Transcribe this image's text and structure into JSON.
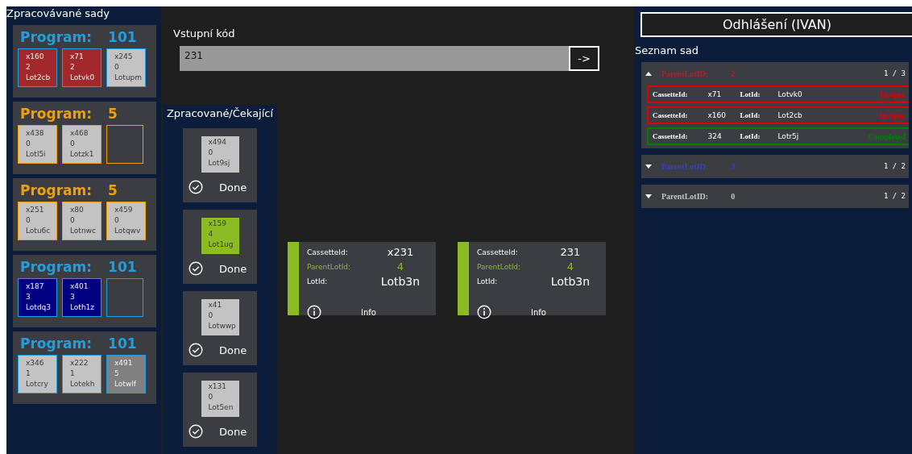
{
  "left_panel": {
    "title": "Zpracovávané sady",
    "programs": [
      {
        "label": "Program:",
        "number": "101",
        "color": "#1ea0e0",
        "tiles": [
          {
            "kind": "lot",
            "color": "#a3282b",
            "cassette": "x160",
            "count": "2",
            "lot": "Lot2cb"
          },
          {
            "kind": "lot",
            "color": "#a3282b",
            "cassette": "x71",
            "count": "2",
            "lot": "Lotvk0"
          },
          {
            "kind": "lot",
            "color": "#c3c3c3",
            "cassette": "x245",
            "count": "0",
            "lot": "Lotupm"
          }
        ]
      },
      {
        "label": "Program:",
        "number": "5",
        "color": "#f0a000",
        "tiles": [
          {
            "kind": "lot",
            "color": "#c3c3c3",
            "cassette": "x438",
            "count": "0",
            "lot": "Lotl5i"
          },
          {
            "kind": "lot",
            "color": "#c3c3c3",
            "cassette": "x468",
            "count": "0",
            "lot": "Lotzk1"
          },
          {
            "kind": "empty"
          }
        ]
      },
      {
        "label": "Program:",
        "number": "5",
        "color": "#f0a000",
        "tiles": [
          {
            "kind": "lot",
            "color": "#c3c3c3",
            "cassette": "x251",
            "count": "0",
            "lot": "Lotu6c"
          },
          {
            "kind": "lot",
            "color": "#c3c3c3",
            "cassette": "x80",
            "count": "0",
            "lot": "Lotnwc"
          },
          {
            "kind": "lot",
            "color": "#c3c3c3",
            "cassette": "x459",
            "count": "0",
            "lot": "Lotqwv"
          }
        ]
      },
      {
        "label": "Program:",
        "number": "101",
        "color": "#1ea0e0",
        "tiles": [
          {
            "kind": "lot",
            "color": "#000080",
            "cassette": "x187",
            "count": "3",
            "lot": "Lotdq3"
          },
          {
            "kind": "lot",
            "color": "#000080",
            "cassette": "x401",
            "count": "3",
            "lot": "Loth1z"
          },
          {
            "kind": "empty"
          }
        ]
      },
      {
        "label": "Program:",
        "number": "101",
        "color": "#1ea0e0",
        "tiles": [
          {
            "kind": "lot",
            "color": "#c3c3c3",
            "cassette": "x346",
            "count": "1",
            "lot": "Lotcry"
          },
          {
            "kind": "lot",
            "color": "#c3c3c3",
            "cassette": "x222",
            "count": "1",
            "lot": "Lotekh"
          },
          {
            "kind": "lot",
            "color": "#808080",
            "cassette": "x491",
            "count": "5",
            "lot": "Lotwlf"
          }
        ]
      }
    ]
  },
  "input": {
    "label": "Vstupní kód",
    "value": "231",
    "button": "->"
  },
  "queue": {
    "title": "Zpracované/Čekající",
    "items": [
      {
        "color": "#c3c3c3",
        "cassette": "x494",
        "count": "0",
        "lot": "Lot9sj",
        "status": "Done"
      },
      {
        "color": "#8cbc24",
        "cassette": "x159",
        "count": "4",
        "lot": "Lot1ug",
        "status": "Done"
      },
      {
        "color": "#c3c3c3",
        "cassette": "x41",
        "count": "0",
        "lot": "Lotwwp",
        "status": "Done"
      },
      {
        "color": "#c3c3c3",
        "cassette": "x131",
        "count": "0",
        "lot": "Lot5en",
        "status": "Done"
      }
    ]
  },
  "info_cards": [
    {
      "color": "#8cbc24",
      "cassette_label": "CassetteId:",
      "cassette": "x231",
      "parent_label": "ParentLotId:",
      "parent": "4",
      "lot_label": "LotId:",
      "lot": "Lotb3n",
      "info": "Info"
    },
    {
      "color": "#8cbc24",
      "cassette_label": "CassetteId:",
      "cassette": "231",
      "parent_label": "ParentLotId:",
      "parent": "4",
      "lot_label": "LotId:",
      "lot": "Lotb3n",
      "info": "Info"
    }
  ],
  "right_panel": {
    "logout": "Odhlášení (IVAN)",
    "title": "Seznam sad",
    "groups": [
      {
        "label": "ParentLotID:",
        "value": "2",
        "color": "#a3282b",
        "expanded": true,
        "page": "1 / 3",
        "rows": [
          {
            "cassette_label": "CassetteId:",
            "cassette": "x71",
            "lot_label": "LotId:",
            "lot": "Lotvk0",
            "status": "In Spec",
            "color": "#e00000"
          },
          {
            "cassette_label": "CassetteId:",
            "cassette": "x160",
            "lot_label": "LotId:",
            "lot": "Lot2cb",
            "status": "In Spec",
            "color": "#e00000"
          },
          {
            "cassette_label": "CassetteId:",
            "cassette": "324",
            "lot_label": "LotId:",
            "lot": "Lotr5j",
            "status": "Completed",
            "color": "#008000"
          }
        ]
      },
      {
        "label": "ParentLotID:",
        "value": "3",
        "color": "#3c3cd0",
        "expanded": false,
        "page": "1 / 2"
      },
      {
        "label": "ParentLotID:",
        "value": "0",
        "color": "#c3c3c3",
        "expanded": false,
        "page": "1 / 2"
      }
    ]
  }
}
